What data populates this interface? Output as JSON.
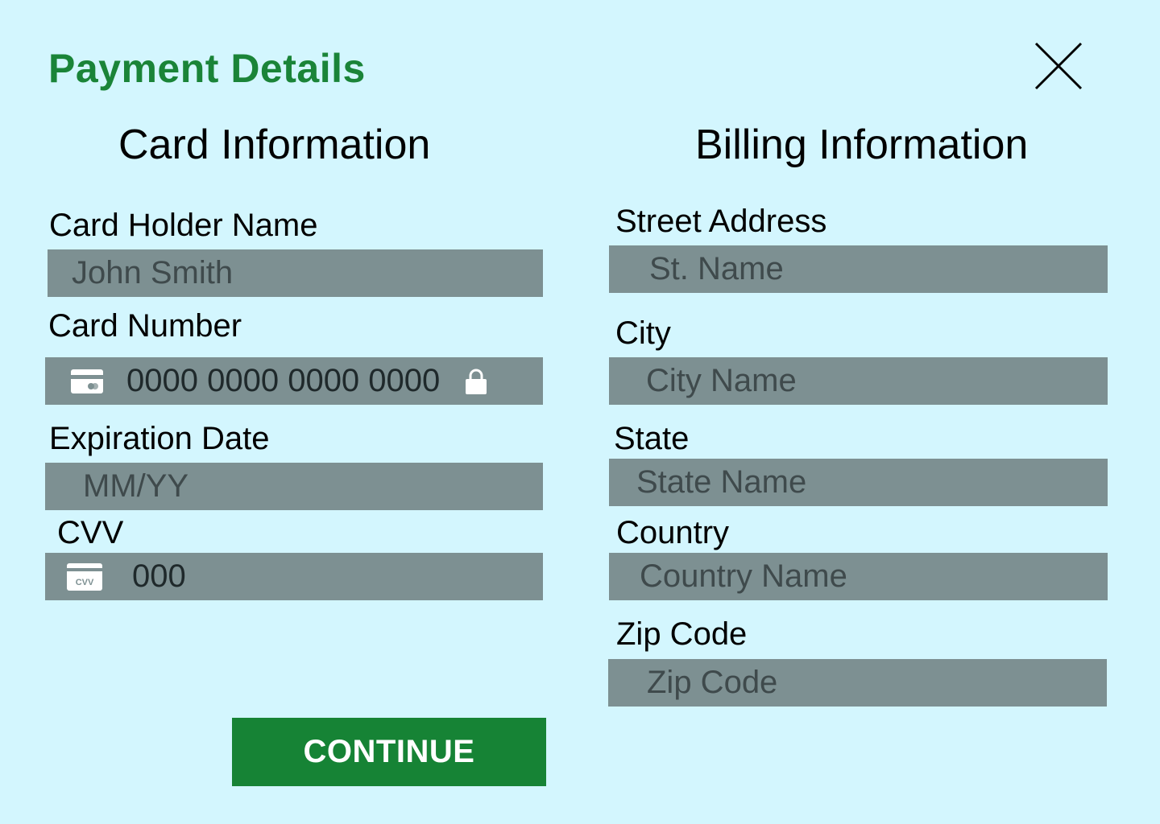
{
  "header": {
    "title": "Payment Details",
    "close_icon": "close-icon"
  },
  "card": {
    "heading": "Card Information",
    "holder_label": "Card Holder Name",
    "holder_placeholder": "John Smith",
    "number_label": "Card Number",
    "number_placeholder": "0000 0000 0000 0000",
    "number_left_icon": "credit-card-icon",
    "number_right_icon": "lock-icon",
    "expiry_label": "Expiration Date",
    "expiry_placeholder": "MM/YY",
    "cvv_label": "CVV",
    "cvv_icon_text": "CVV",
    "cvv_placeholder": "000",
    "cvv_icon": "cvv-card-icon"
  },
  "billing": {
    "heading": "Billing Information",
    "street_label": "Street Address",
    "street_placeholder": "St. Name",
    "city_label": "City",
    "city_placeholder": "City Name",
    "state_label": "State",
    "state_placeholder": "State Name",
    "country_label": "Country",
    "country_placeholder": "Country Name",
    "zip_label": "Zip Code",
    "zip_placeholder": "Zip Code"
  },
  "actions": {
    "continue_label": "CONTINUE"
  },
  "colors": {
    "background": "#d3f6fe",
    "accent": "#1a8438",
    "field": "#7d9092"
  }
}
